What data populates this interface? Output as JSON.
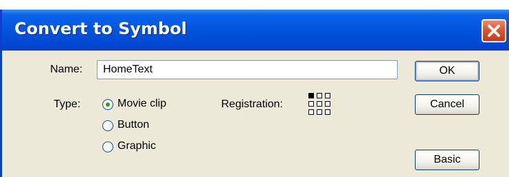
{
  "dialog": {
    "title": "Convert to Symbol",
    "close_icon": "close-icon"
  },
  "form": {
    "name_label": "Name:",
    "name_value": "HomeText",
    "type_label": "Type:",
    "type_options": [
      {
        "label": "Movie clip",
        "selected": true
      },
      {
        "label": "Button",
        "selected": false
      },
      {
        "label": "Graphic",
        "selected": false
      }
    ],
    "registration_label": "Registration:",
    "registration_selected": "top-left"
  },
  "buttons": {
    "ok": "OK",
    "cancel": "Cancel",
    "basic": "Basic"
  },
  "colors": {
    "titlebar": "#0052dc",
    "close_button": "#e2542f",
    "dialog_bg": "#ece9d8",
    "radio_selected": "#21a121"
  }
}
